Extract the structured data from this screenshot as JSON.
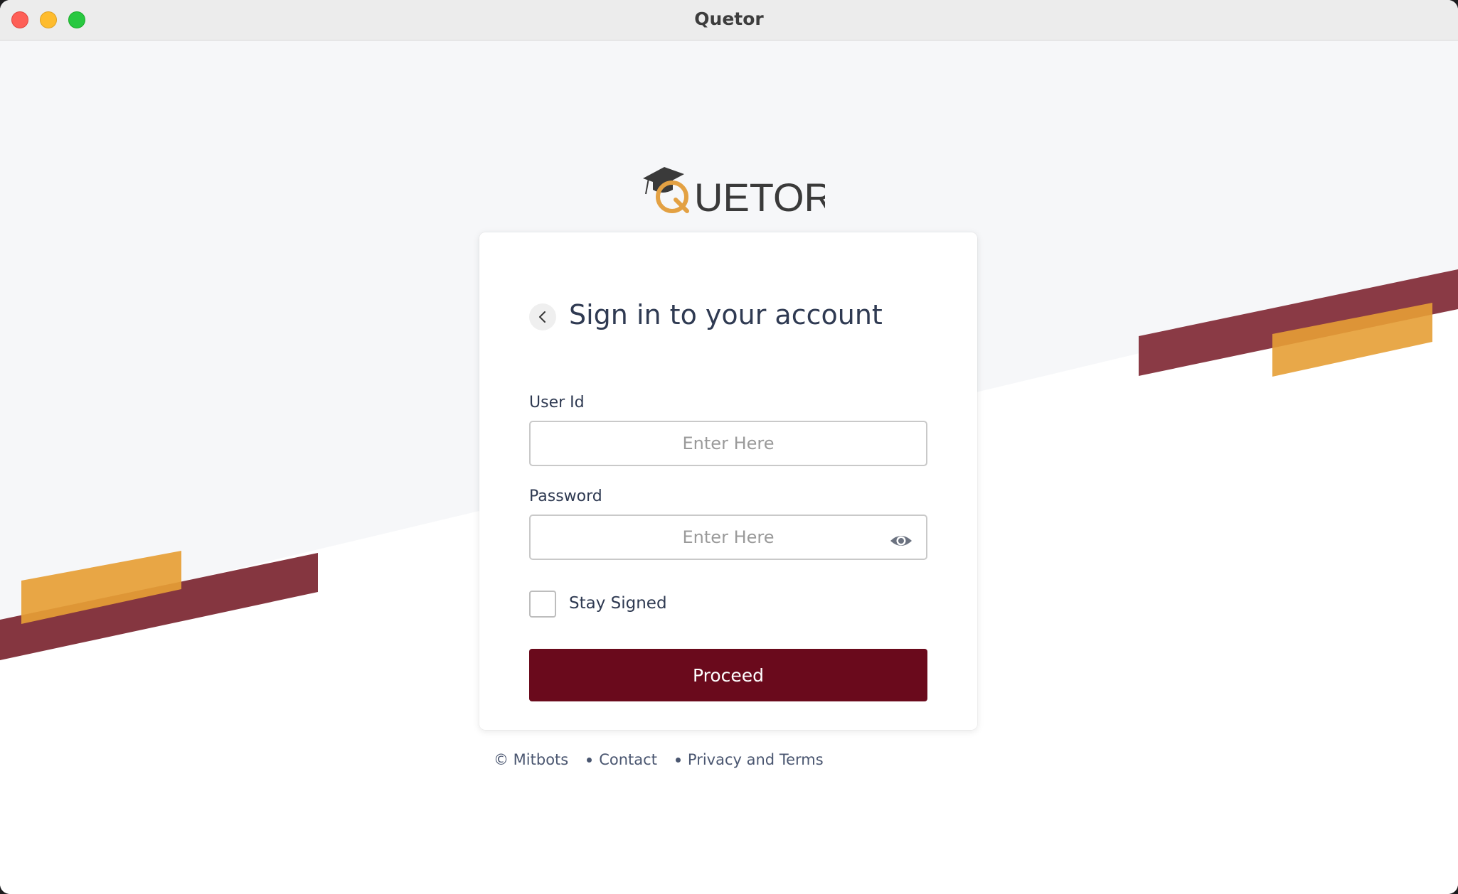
{
  "window": {
    "title": "Quetor"
  },
  "brand": {
    "logo_text": "UETOR",
    "logo_letter": "Q",
    "colors": {
      "primary": "#6a0a1c",
      "accent": "#e3a143",
      "band": "#853640"
    }
  },
  "signin": {
    "title": "Sign in to your account",
    "back_icon": "chevron-left-icon",
    "user_id_label": "User Id",
    "user_id_placeholder": "Enter Here",
    "user_id_value": "",
    "password_label": "Password",
    "password_placeholder": "Enter Here",
    "password_value": "",
    "password_toggle_icon": "eye-icon",
    "stay_signed_label": "Stay Signed",
    "stay_signed_checked": false,
    "proceed_label": "Proceed"
  },
  "footer": {
    "copyright": "© Mitbots",
    "contact": "Contact",
    "privacy": "Privacy and Terms"
  }
}
